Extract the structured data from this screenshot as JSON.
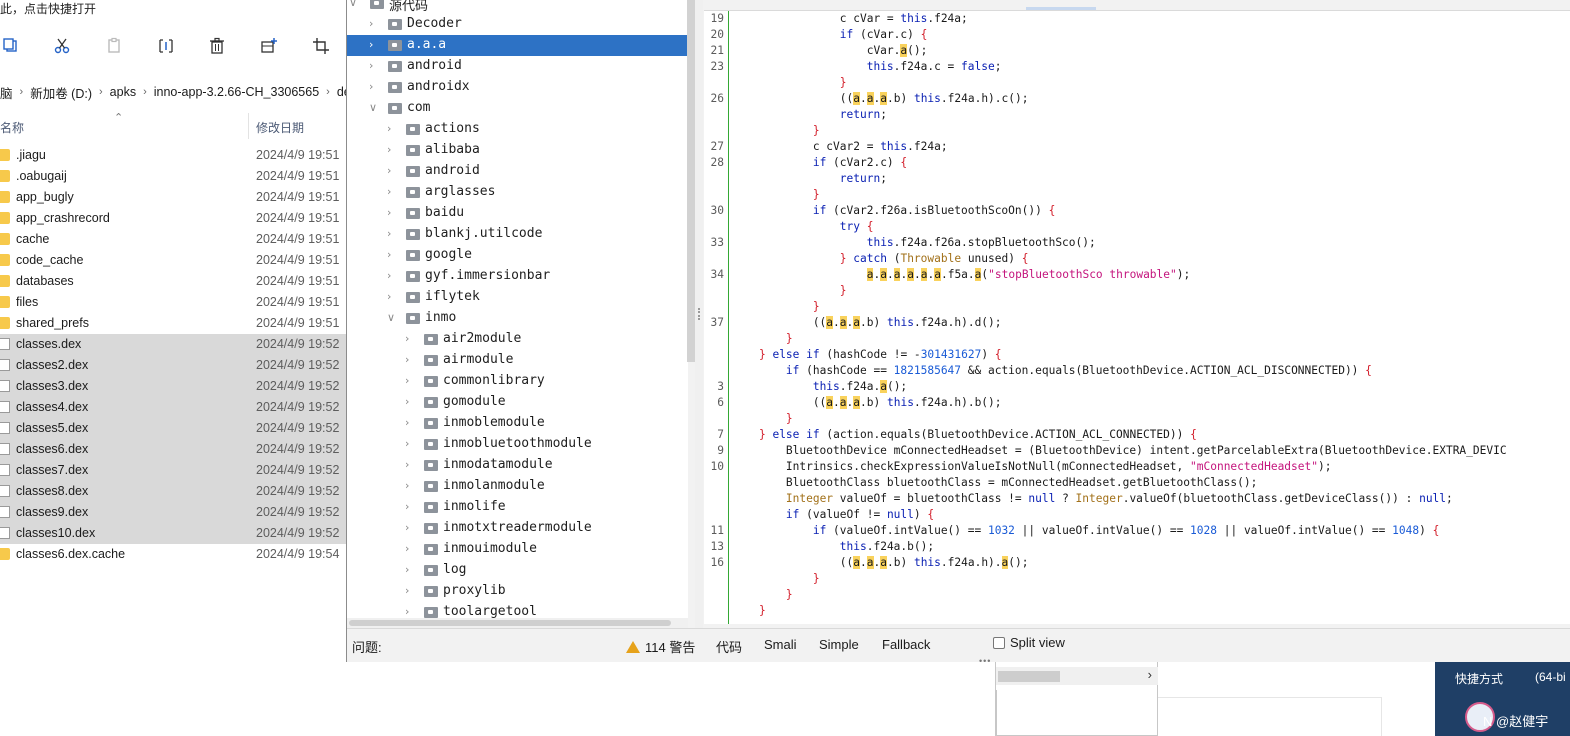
{
  "explorer": {
    "hint": "此，点击快捷打开",
    "breadcrumb": [
      "脑",
      "新加卷 (D:)",
      "apks",
      "inno-app-3.2.66-CH_3306565",
      "de"
    ],
    "col_name": "名称",
    "col_date": "修改日期",
    "files": [
      {
        "name": ".jiagu",
        "date": "2024/4/9 19:51"
      },
      {
        "name": ".oabugaij",
        "date": "2024/4/9 19:51"
      },
      {
        "name": "app_bugly",
        "date": "2024/4/9 19:51"
      },
      {
        "name": "app_crashrecord",
        "date": "2024/4/9 19:51"
      },
      {
        "name": "cache",
        "date": "2024/4/9 19:51"
      },
      {
        "name": "code_cache",
        "date": "2024/4/9 19:51"
      },
      {
        "name": "databases",
        "date": "2024/4/9 19:51"
      },
      {
        "name": "files",
        "date": "2024/4/9 19:51"
      },
      {
        "name": "shared_prefs",
        "date": "2024/4/9 19:51"
      },
      {
        "name": "classes.dex",
        "date": "2024/4/9 19:52"
      },
      {
        "name": "classes2.dex",
        "date": "2024/4/9 19:52"
      },
      {
        "name": "classes3.dex",
        "date": "2024/4/9 19:52"
      },
      {
        "name": "classes4.dex",
        "date": "2024/4/9 19:52"
      },
      {
        "name": "classes5.dex",
        "date": "2024/4/9 19:52"
      },
      {
        "name": "classes6.dex",
        "date": "2024/4/9 19:52"
      },
      {
        "name": "classes7.dex",
        "date": "2024/4/9 19:52"
      },
      {
        "name": "classes8.dex",
        "date": "2024/4/9 19:52"
      },
      {
        "name": "classes9.dex",
        "date": "2024/4/9 19:52"
      },
      {
        "name": "classes10.dex",
        "date": "2024/4/9 19:52"
      },
      {
        "name": "classes6.dex.cache",
        "date": "2024/4/9 19:54"
      }
    ]
  },
  "tree": {
    "items": [
      {
        "label": "源代码"
      },
      {
        "label": "Decoder"
      },
      {
        "label": "a.a.a"
      },
      {
        "label": "android"
      },
      {
        "label": "androidx"
      },
      {
        "label": "com"
      },
      {
        "label": "actions"
      },
      {
        "label": "alibaba"
      },
      {
        "label": "android"
      },
      {
        "label": "arglasses"
      },
      {
        "label": "baidu"
      },
      {
        "label": "blankj.utilcode"
      },
      {
        "label": "google"
      },
      {
        "label": "gyf.immersionbar"
      },
      {
        "label": "iflytek"
      },
      {
        "label": "inmo"
      },
      {
        "label": "air2module"
      },
      {
        "label": "airmodule"
      },
      {
        "label": "commonlibrary"
      },
      {
        "label": "gomodule"
      },
      {
        "label": "inmoblemodule"
      },
      {
        "label": "inmobluetoothmodule"
      },
      {
        "label": "inmodatamodule"
      },
      {
        "label": "inmolanmodule"
      },
      {
        "label": "inmolife"
      },
      {
        "label": "inmotxtreadermodule"
      },
      {
        "label": "inmouimodule"
      },
      {
        "label": "log"
      },
      {
        "label": "proxylib"
      },
      {
        "label": "toolargetool"
      }
    ]
  },
  "code": {
    "lines": [
      {
        "ln": "19",
        "src": "                c cVar = this.f24a;"
      },
      {
        "ln": "20",
        "src": "                if (cVar.c) {"
      },
      {
        "ln": "21",
        "src": "                    cVar.a();"
      },
      {
        "ln": "23",
        "src": "                    this.f24a.c = false;"
      },
      {
        "ln": "",
        "src": "                }"
      },
      {
        "ln": "26",
        "src": "                ((a.a.a.b) this.f24a.h).c();"
      },
      {
        "ln": "",
        "src": "                return;"
      },
      {
        "ln": "",
        "src": "            }"
      },
      {
        "ln": "27",
        "src": "            c cVar2 = this.f24a;"
      },
      {
        "ln": "28",
        "src": "            if (cVar2.c) {"
      },
      {
        "ln": "",
        "src": "                return;"
      },
      {
        "ln": "",
        "src": "            }"
      },
      {
        "ln": "30",
        "src": "            if (cVar2.f26a.isBluetoothScoOn()) {"
      },
      {
        "ln": "",
        "src": "                try {"
      },
      {
        "ln": "33",
        "src": "                    this.f24a.f26a.stopBluetoothSco();"
      },
      {
        "ln": "",
        "src": "                } catch (Throwable unused) {"
      },
      {
        "ln": "34",
        "src": "                    a.a.a.a.a.a.f5a.a(\"stopBluetoothSco throwable\");"
      },
      {
        "ln": "",
        "src": "                }"
      },
      {
        "ln": "",
        "src": "            }"
      },
      {
        "ln": "37",
        "src": "            ((a.a.a.b) this.f24a.h).d();"
      },
      {
        "ln": "",
        "src": "        }"
      },
      {
        "ln": "",
        "src": "    } else if (hashCode != -301431627) {"
      },
      {
        "ln": "",
        "src": "        if (hashCode == 1821585647 && action.equals(BluetoothDevice.ACTION_ACL_DISCONNECTED)) {"
      },
      {
        "ln": "3",
        "src": "            this.f24a.a();"
      },
      {
        "ln": "6",
        "src": "            ((a.a.a.b) this.f24a.h).b();"
      },
      {
        "ln": "",
        "src": "        }"
      },
      {
        "ln": "7",
        "src": "    } else if (action.equals(BluetoothDevice.ACTION_ACL_CONNECTED)) {"
      },
      {
        "ln": "9",
        "src": "        BluetoothDevice mConnectedHeadset = (BluetoothDevice) intent.getParcelableExtra(BluetoothDevice.EXTRA_DEVIC"
      },
      {
        "ln": "10",
        "src": "        Intrinsics.checkExpressionValueIsNotNull(mConnectedHeadset, \"mConnectedHeadset\");"
      },
      {
        "ln": "",
        "src": "        BluetoothClass bluetoothClass = mConnectedHeadset.getBluetoothClass();"
      },
      {
        "ln": "",
        "src": "        Integer valueOf = bluetoothClass != null ? Integer.valueOf(bluetoothClass.getDeviceClass()) : null;"
      },
      {
        "ln": "",
        "src": "        if (valueOf != null) {"
      },
      {
        "ln": "11",
        "src": "            if (valueOf.intValue() == 1032 || valueOf.intValue() == 1028 || valueOf.intValue() == 1048) {"
      },
      {
        "ln": "13",
        "src": "                this.f24a.b();"
      },
      {
        "ln": "16",
        "src": "                ((a.a.a.b) this.f24a.h).a();"
      },
      {
        "ln": "",
        "src": "            }"
      },
      {
        "ln": "",
        "src": "        }"
      },
      {
        "ln": "",
        "src": "    }"
      }
    ]
  },
  "status": {
    "issues_label": "问题:",
    "warnings": "114 警告",
    "tab_code": "代码",
    "tab_smali": "Smali",
    "tab_simple": "Simple",
    "tab_fallback": "Fallback",
    "split_view": "Split view"
  },
  "background": {
    "desktop_col1_top": "...",
    "desktop_shortcut": "快捷方式",
    "desktop_arch": "(64-bi",
    "watermark": "N @赵健宇"
  },
  "colors": {
    "selection": "#2d72c5",
    "highlight": "#f9d25c",
    "keyword": "#0b21b3",
    "string": "#c4157d",
    "number": "#1a5bd6",
    "warning": "#e6a21b"
  }
}
